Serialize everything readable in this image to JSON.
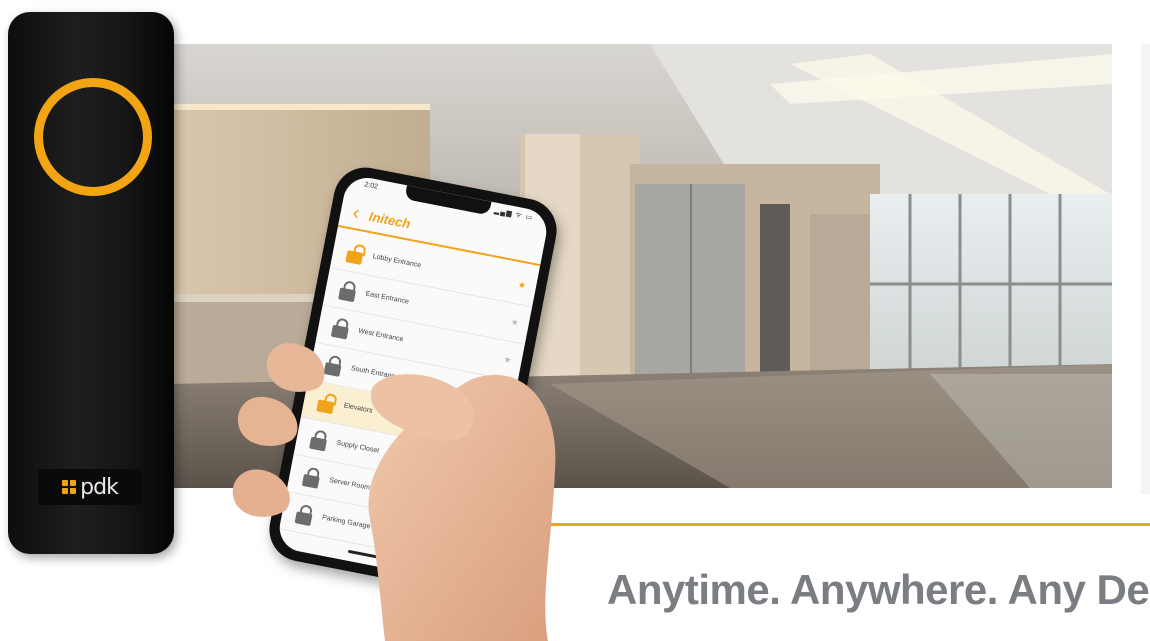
{
  "tagline": "Anytime. Anywhere. Any De",
  "reader": {
    "logo_text": "pdk",
    "ring_color": "#f2a413"
  },
  "phone": {
    "status_time": "2:02",
    "status_icons": "▂▄▆ ᯤ ▭",
    "back_glyph": "‹",
    "app_title": "Initech",
    "doors": [
      {
        "label": "Lobby Entrance",
        "lock": "unlocked",
        "favorite": true
      },
      {
        "label": "East Entrance",
        "lock": "locked",
        "favorite": false
      },
      {
        "label": "West Entrance",
        "lock": "locked",
        "favorite": false
      },
      {
        "label": "South Entrance",
        "lock": "locked",
        "favorite": false
      },
      {
        "label": "Elevators",
        "lock": "unlocked",
        "favorite": false,
        "selected": true
      },
      {
        "label": "Supply Closet",
        "lock": "locked",
        "favorite": false
      },
      {
        "label": "Server Room",
        "lock": "locked",
        "favorite": false
      },
      {
        "label": "Parking Garage",
        "lock": "locked",
        "favorite": false
      }
    ]
  },
  "colors": {
    "accent": "#f0a21a",
    "tagline": "#7a7d82",
    "reader_body": "#161616"
  }
}
